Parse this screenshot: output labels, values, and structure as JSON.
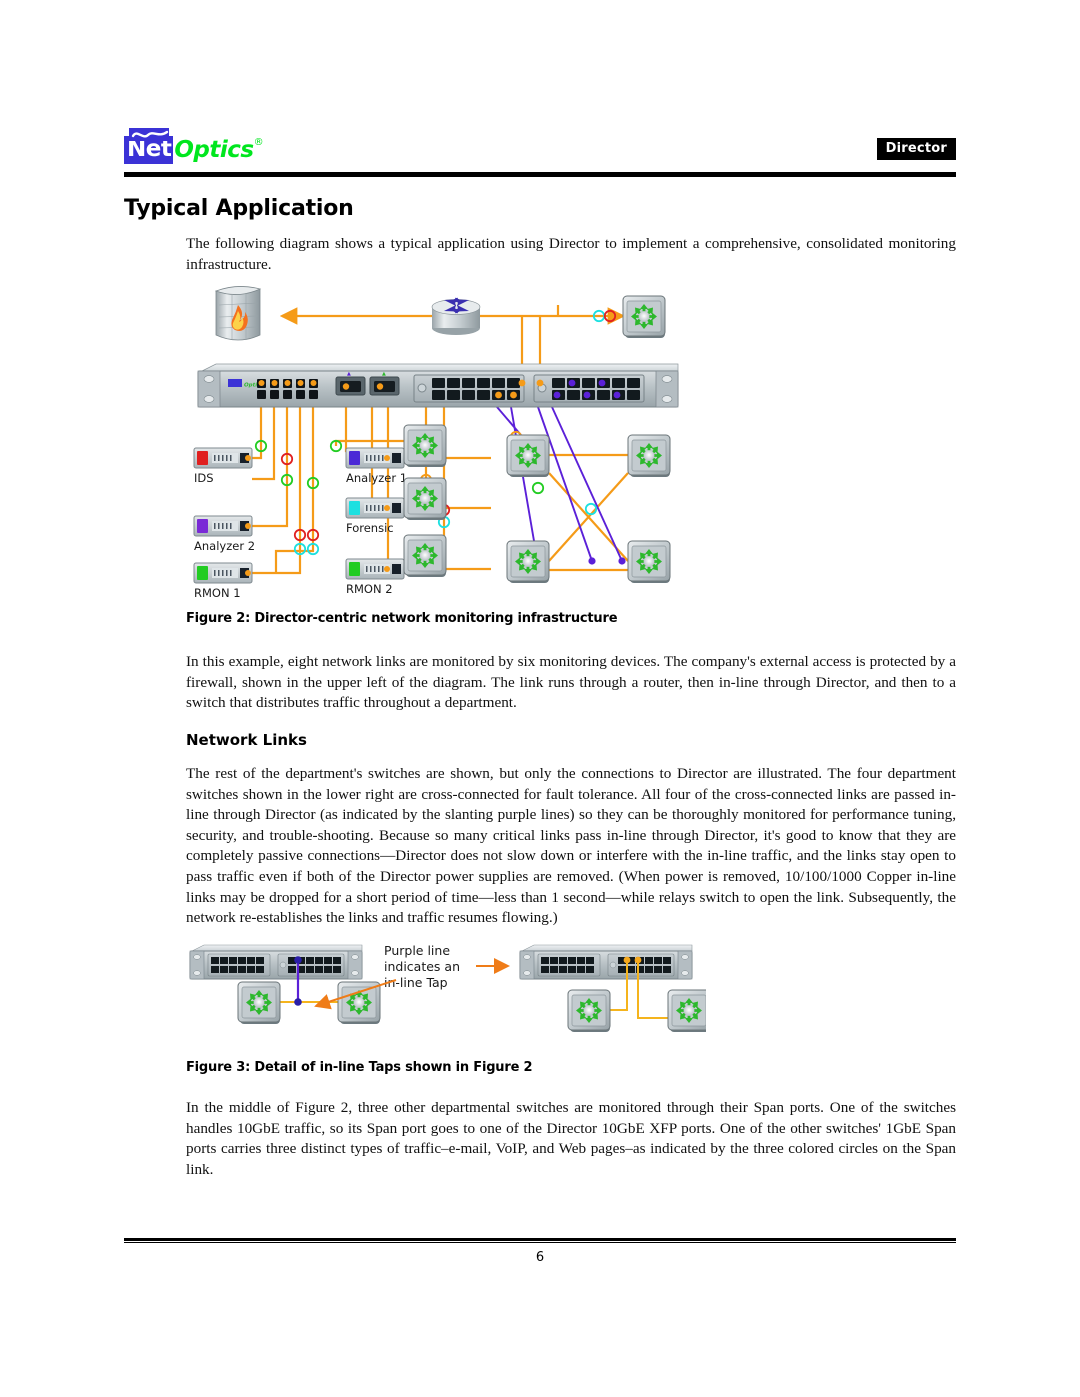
{
  "header": {
    "logo_net": "Net",
    "logo_optics": "Optics",
    "logo_reg": "®",
    "doc_tag": "Director"
  },
  "page_title": "Typical Application",
  "intro_paragraph": "The following diagram shows a typical application using Director to implement a comprehensive, consolidated monitoring infrastructure.",
  "figure2": {
    "caption": "Figure 2: Director-centric network monitoring infrastructure",
    "devices": [
      {
        "label": "IDS",
        "color": "#e02020"
      },
      {
        "label": "Analyzer 1",
        "color": "#4b2ad6"
      },
      {
        "label": "Analyzer 2",
        "color": "#7a2ad6"
      },
      {
        "label": "Forensic",
        "color": "#1ce0e0"
      },
      {
        "label": "RMON 1",
        "color": "#22cc22"
      },
      {
        "label": "RMON 2",
        "color": "#22cc22"
      }
    ],
    "link_color": "#f59b18",
    "tap_color": "#5b20d8",
    "span_circle_colors": [
      "#e02020",
      "#22cc22",
      "#1ce0e0"
    ]
  },
  "paragraph_after_fig2": "In this example, eight network links are monitored by six monitoring devices. The company's external access is protected by a firewall, shown in the upper left of the diagram. The link runs through a router, then in-line through Director, and then to a switch that distributes traffic throughout a department.",
  "network_links": {
    "heading": "Network Links",
    "paragraph": "The rest of the department's switches are shown, but only the connections to Director are illustrated. The four department switches shown in the lower right are cross-connected for fault tolerance. All four of the cross-connected links are passed in-line through Director (as indicated by the slanting purple lines) so they can be thoroughly monitored for performance tuning, security, and trouble-shooting. Because so many critical links pass in-line through Director, it's good to know that they are completely passive connections—Director does not slow down or interfere with the in-line traffic, and the links stay open to pass traffic even if both of the Director power supplies are removed. (When power is removed, 10/100/1000 Copper in-line links may be dropped for a short period of time—less than 1 second—while relays switch to open the link. Subsequently, the network re-establishes the links and traffic resumes flowing.)"
  },
  "figure3": {
    "caption": "Figure 3: Detail of in-line Taps shown in Figure 2",
    "annotation_line1": "Purple line",
    "annotation_line2": "indicates an",
    "annotation_line3": "in-line Tap"
  },
  "paragraph_after_fig3": "In the middle of Figure 2, three other departmental switches are monitored through their Span ports. One of the switches handles 10GbE traffic, so its Span port goes to one of the Director 10GbE XFP ports. One of the other switches' 1GbE Span ports carries three distinct types of traffic–e-mail, VoIP, and Web pages–as indicated by the three colored circles on the Span link.",
  "footer": {
    "page_number": "6"
  }
}
